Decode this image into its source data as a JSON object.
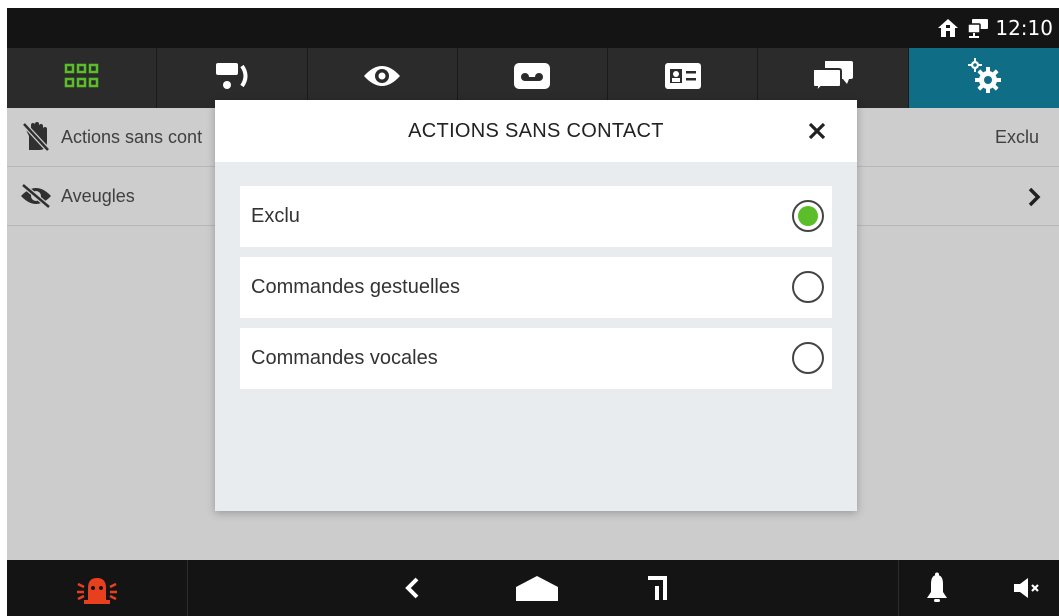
{
  "status_bar": {
    "time": "12:10",
    "icons": [
      "home-icon",
      "network-icon"
    ]
  },
  "tabs": [
    {
      "icon": "grid-icon",
      "active": false
    },
    {
      "icon": "intercom-icon",
      "active": false
    },
    {
      "icon": "eye-icon",
      "active": false
    },
    {
      "icon": "voicemail-icon",
      "active": false
    },
    {
      "icon": "contact-card-icon",
      "active": false
    },
    {
      "icon": "chat-icon",
      "active": false
    },
    {
      "icon": "settings-icon",
      "active": true
    }
  ],
  "list": {
    "rows": [
      {
        "label": "Actions sans cont",
        "value": "Exclu",
        "icon": "no-touch-icon"
      },
      {
        "label": "Aveugles",
        "icon": "eye-slash-icon",
        "chevron": "chevron-right-icon"
      }
    ]
  },
  "dialog": {
    "title": "ACTIONS SANS CONTACT",
    "close_icon": "close-icon",
    "options": [
      {
        "label": "Exclu",
        "selected": true
      },
      {
        "label": "Commandes gestuelles",
        "selected": false
      },
      {
        "label": "Commandes vocales",
        "selected": false
      }
    ]
  },
  "nav_bar": {
    "icons": [
      "alarm-icon",
      "back-icon",
      "home-icon",
      "recent-icon",
      "bell-icon",
      "mute-icon"
    ]
  },
  "colors": {
    "accent_tab": "#0f6d86",
    "tab_icon_green": "#5bbd2a",
    "radio_selected": "#5bbd2a",
    "alarm_red": "#e8401f"
  }
}
